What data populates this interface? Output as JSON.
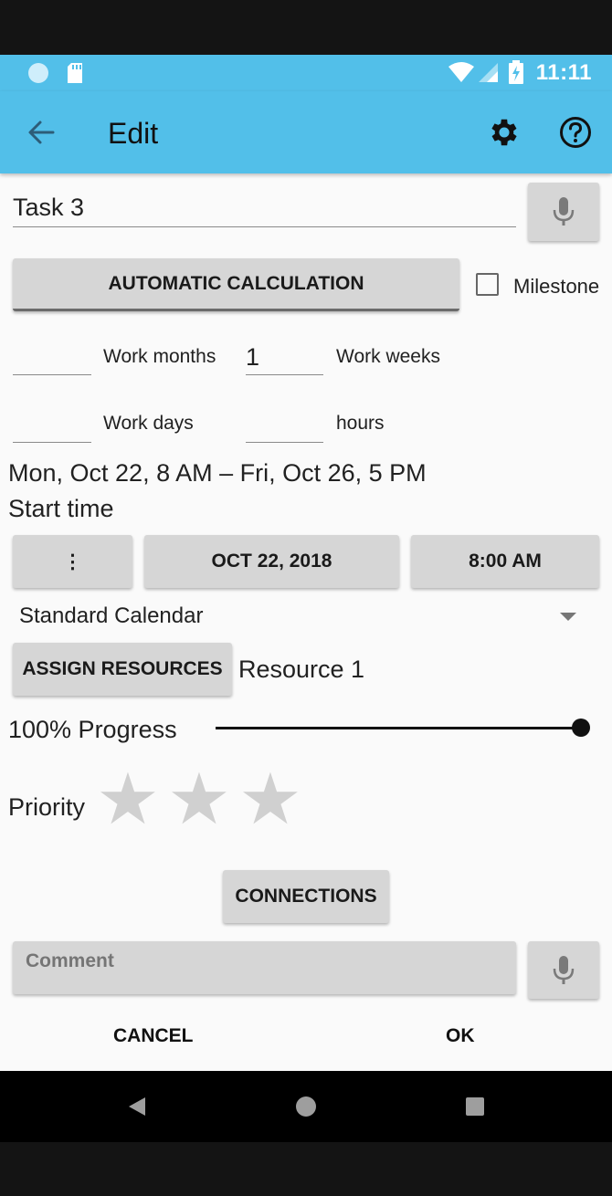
{
  "status_bar": {
    "time": "11:11"
  },
  "app_bar": {
    "title": "Edit"
  },
  "task": {
    "name": "Task 3"
  },
  "auto_calc": {
    "label": "AUTOMATIC CALCULATION"
  },
  "milestone": {
    "label": "Milestone",
    "checked": false
  },
  "duration": {
    "months_value": "",
    "months_label": "Work months",
    "weeks_value": "1",
    "weeks_label": "Work weeks",
    "days_value": "",
    "days_label": "Work days",
    "hours_value": "",
    "hours_label": "hours"
  },
  "schedule": {
    "range_text": "Mon, Oct 22, 8 AM – Fri, Oct 26, 5 PM",
    "start_label": "Start time"
  },
  "start_buttons": {
    "more": "⋮",
    "date": "OCT 22, 2018",
    "time": "8:00 AM"
  },
  "calendar": {
    "selected": "Standard Calendar"
  },
  "resources": {
    "button": "ASSIGN RESOURCES",
    "assigned": "Resource 1"
  },
  "progress": {
    "label": "100% Progress",
    "value": 100
  },
  "priority": {
    "label": "Priority",
    "stars": 0,
    "max": 3
  },
  "connections": {
    "label": "CONNECTIONS"
  },
  "comment": {
    "placeholder": "Comment",
    "value": ""
  },
  "dialog": {
    "cancel": "CANCEL",
    "ok": "OK"
  },
  "colors": {
    "app_bar": "#52bfe9",
    "button": "#d6d6d6",
    "background": "#fafafa"
  }
}
